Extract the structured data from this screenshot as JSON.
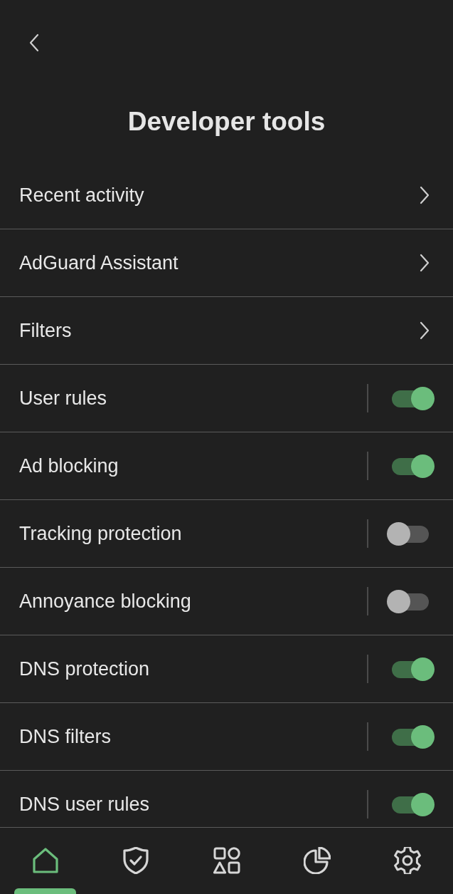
{
  "header": {
    "title": "Developer tools"
  },
  "rows": [
    {
      "label": "Recent activity",
      "kind": "link"
    },
    {
      "label": "AdGuard Assistant",
      "kind": "link"
    },
    {
      "label": "Filters",
      "kind": "link"
    },
    {
      "label": "User rules",
      "kind": "toggle",
      "on": true
    },
    {
      "label": "Ad blocking",
      "kind": "toggle",
      "on": true
    },
    {
      "label": "Tracking protection",
      "kind": "toggle",
      "on": false
    },
    {
      "label": "Annoyance blocking",
      "kind": "toggle",
      "on": false
    },
    {
      "label": "DNS protection",
      "kind": "toggle",
      "on": true
    },
    {
      "label": "DNS filters",
      "kind": "toggle",
      "on": true
    },
    {
      "label": "DNS user rules",
      "kind": "toggle",
      "on": true
    }
  ],
  "bottom_nav": [
    {
      "selected": true
    },
    {
      "selected": false
    },
    {
      "selected": false
    },
    {
      "selected": false
    },
    {
      "selected": false
    }
  ]
}
